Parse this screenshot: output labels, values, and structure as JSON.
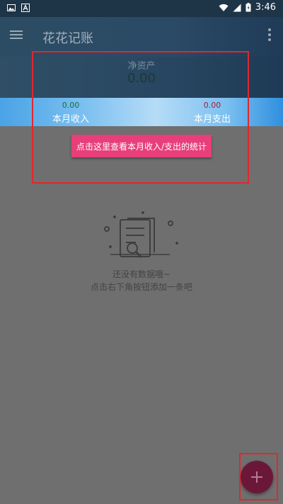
{
  "status_bar": {
    "left_icons": [
      "image-icon",
      "app-a-icon"
    ],
    "right_icons": [
      "wifi-icon",
      "signal-icon",
      "battery-icon"
    ],
    "time": "3:46"
  },
  "toolbar": {
    "menu_icon": "menu-icon",
    "title": "花花记账",
    "more_icon": "more-vert-icon"
  },
  "summary": {
    "net_assets_label": "净资产",
    "net_assets_value": "0.00",
    "income_value": "0.00",
    "income_label": "本月收入",
    "expense_value": "0.00",
    "expense_label": "本月支出",
    "stats_button_label": "点击这里查看本月收入/支出的统计"
  },
  "empty_state": {
    "illustration_icon": "empty-document-search-icon",
    "line1": "还没有数据哦~",
    "line2": "点击右下角按钮添加一条吧"
  },
  "fab": {
    "icon": "plus-icon"
  },
  "colors": {
    "toolbar": "#2b4a66",
    "income": "#1a6b3c",
    "expense": "#a0213b",
    "stats_button": "#e83f7a",
    "fab": "#6b1838",
    "highlight": "#e0272f"
  }
}
